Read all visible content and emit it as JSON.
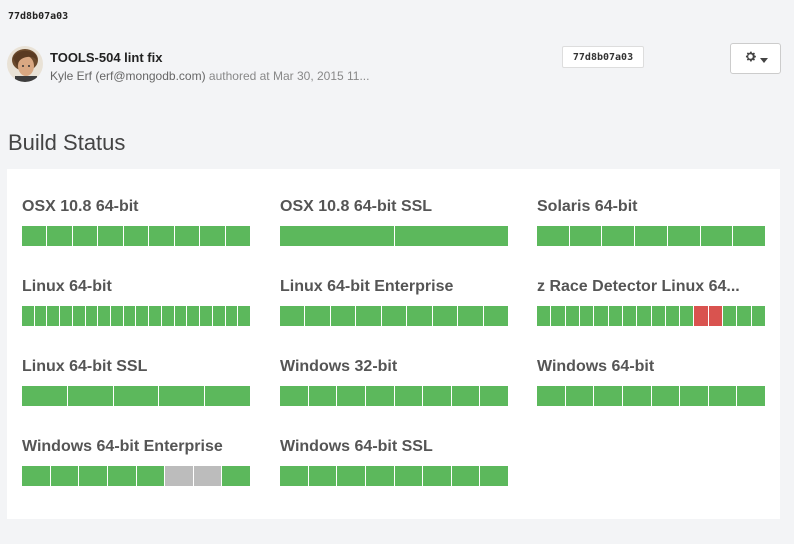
{
  "commit": {
    "hash_top": "77d8b07a03",
    "title": "TOOLS-504 lint fix",
    "author": "Kyle Erf (erf@mongodb.com)",
    "authored_text": "authored at Mar 30, 2015 11...",
    "hash_badge": "77d8b07a03"
  },
  "section_title": "Build Status",
  "colors": {
    "success": "#5cb85c",
    "failed": "#d9534f",
    "inactive": "#bcbcbc"
  },
  "variants": [
    {
      "name": "OSX 10.8 64-bit",
      "tasks": [
        "success",
        "success",
        "success",
        "success",
        "success",
        "success",
        "success",
        "success",
        "success"
      ]
    },
    {
      "name": "OSX 10.8 64-bit SSL",
      "tasks": [
        "success",
        "success"
      ]
    },
    {
      "name": "Solaris 64-bit",
      "tasks": [
        "success",
        "success",
        "success",
        "success",
        "success",
        "success",
        "success"
      ]
    },
    {
      "name": "Linux 64-bit",
      "tasks": [
        "success",
        "success",
        "success",
        "success",
        "success",
        "success",
        "success",
        "success",
        "success",
        "success",
        "success",
        "success",
        "success",
        "success",
        "success",
        "success",
        "success",
        "success"
      ]
    },
    {
      "name": "Linux 64-bit Enterprise",
      "tasks": [
        "success",
        "success",
        "success",
        "success",
        "success",
        "success",
        "success",
        "success",
        "success"
      ]
    },
    {
      "name": "z Race Detector Linux 64...",
      "tasks": [
        "success",
        "success",
        "success",
        "success",
        "success",
        "success",
        "success",
        "success",
        "success",
        "success",
        "success",
        "failed",
        "failed",
        "success",
        "success",
        "success"
      ]
    },
    {
      "name": "Linux 64-bit SSL",
      "tasks": [
        "success",
        "success",
        "success",
        "success",
        "success"
      ]
    },
    {
      "name": "Windows 32-bit",
      "tasks": [
        "success",
        "success",
        "success",
        "success",
        "success",
        "success",
        "success",
        "success"
      ]
    },
    {
      "name": "Windows 64-bit",
      "tasks": [
        "success",
        "success",
        "success",
        "success",
        "success",
        "success",
        "success",
        "success"
      ]
    },
    {
      "name": "Windows 64-bit Enterprise",
      "tasks": [
        "success",
        "success",
        "success",
        "success",
        "success",
        "inactive",
        "inactive",
        "success"
      ]
    },
    {
      "name": "Windows 64-bit SSL",
      "tasks": [
        "success",
        "success",
        "success",
        "success",
        "success",
        "success",
        "success",
        "success"
      ]
    }
  ],
  "icons": {
    "settings": "gear-icon",
    "dropdown": "caret-down-icon"
  }
}
